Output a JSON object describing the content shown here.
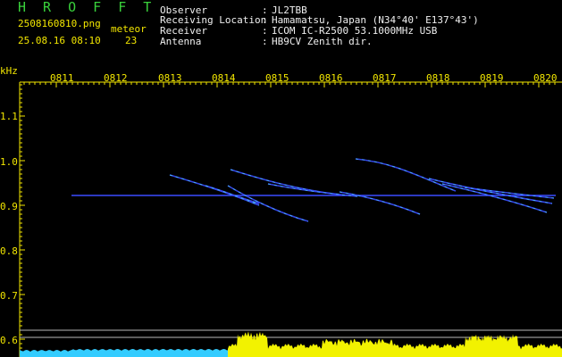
{
  "header": {
    "logo": "H R O F F T",
    "filename": "2508160810.png",
    "datetime": "25.08.16 08:10",
    "meteor_label": "meteor",
    "meteor_count": "23",
    "fields": [
      {
        "label": "Observer",
        "value": "JL2TBB"
      },
      {
        "label": "Receiving Location",
        "value": "Hamamatsu, Japan (N34°40' E137°43')"
      },
      {
        "label": "Receiver",
        "value": "ICOM IC-R2500 53.1000MHz USB"
      },
      {
        "label": "Antenna",
        "value": "HB9CV Zenith dir."
      }
    ]
  },
  "axes": {
    "y_unit": "kHz",
    "x_ticks": [
      "0811",
      "0812",
      "0813",
      "0814",
      "0815",
      "0816",
      "0817",
      "0818",
      "0819",
      "0820"
    ],
    "y_ticks": [
      "1.1",
      "1.0",
      "0.9",
      "0.8",
      "0.7",
      "0.6"
    ]
  },
  "colors": {
    "background": "#000000",
    "text_yellow": "#f2e600",
    "text_white": "#f0f0f0",
    "logo_green": "#39d13b",
    "carrier_blue": "#3a4cff",
    "echo_cyan": "#4dd8ff",
    "noise_yellow": "#f2f200",
    "noise_cyan": "#33ccff"
  }
}
